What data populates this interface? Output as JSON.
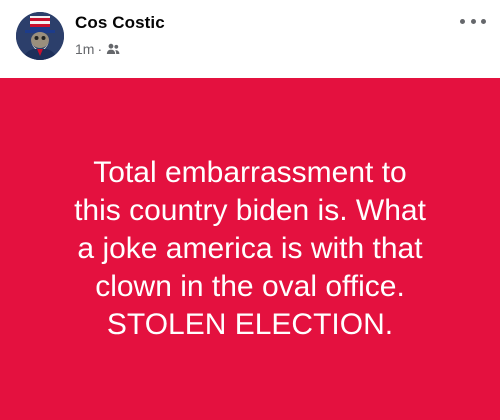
{
  "author": {
    "name": "Cos Costic",
    "avatar_icon": "uncle-sam-avatar"
  },
  "meta": {
    "timestamp": "1m",
    "separator": "·",
    "audience_icon": "friends-icon"
  },
  "menu": {
    "icon": "more-options-icon"
  },
  "post": {
    "background_color": "#e4113f",
    "text_color": "#ffffff",
    "text": "Total embarrassment to\nthis country biden is. What\na joke america is with that\nclown in the oval office.\nSTOLEN ELECTION."
  }
}
